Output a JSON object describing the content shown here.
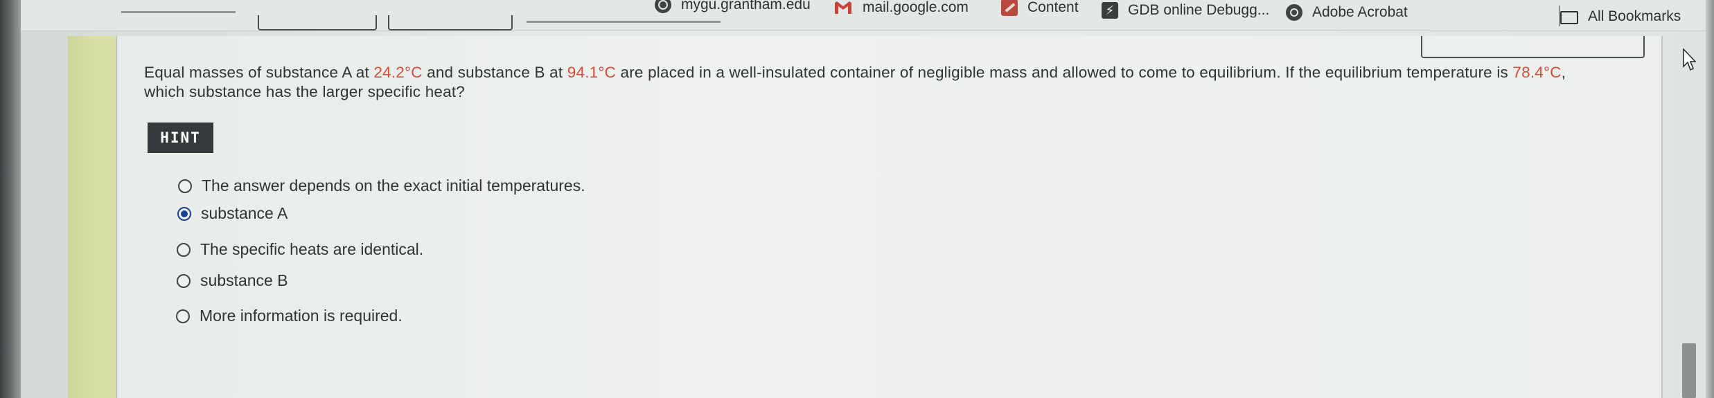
{
  "bookmarks": {
    "items": [
      {
        "label": "mygu.grantham.edu",
        "icon": "globe-icon"
      },
      {
        "label": "mail.google.com",
        "icon": "gmail-icon"
      },
      {
        "label": "Content",
        "icon": "pencil-icon"
      },
      {
        "label": "GDB online Debugg...",
        "icon": "bolt-icon"
      },
      {
        "label": "Adobe Acrobat",
        "icon": "acrobat-icon"
      }
    ],
    "all_bookmarks": {
      "label": "All Bookmarks",
      "icon": "folder-icon"
    }
  },
  "question": {
    "part1": "Equal masses of substance A at ",
    "temp_a": "24.2°C",
    "part2": " and substance B at ",
    "temp_b": "94.1°C",
    "part3": " are placed in a well-insulated container of negligible mass and allowed to come to equilibrium. If the equilibrium temperature is ",
    "temp_eq": "78.4°C",
    "part4": ", which substance has the larger specific heat?"
  },
  "hint": {
    "label": "HINT"
  },
  "options": [
    {
      "label": "The answer depends on the exact initial temperatures.",
      "selected": false
    },
    {
      "label": "substance A",
      "selected": true
    },
    {
      "label": "The specific heats are identical.",
      "selected": false
    },
    {
      "label": "substance B",
      "selected": false
    },
    {
      "label": "More information is required.",
      "selected": false
    }
  ],
  "colors": {
    "accent_red": "#d64a3a",
    "selected_radio": "#1b3f92",
    "hint_bg": "#343a3b",
    "side_strip": "#d5dc9b"
  }
}
